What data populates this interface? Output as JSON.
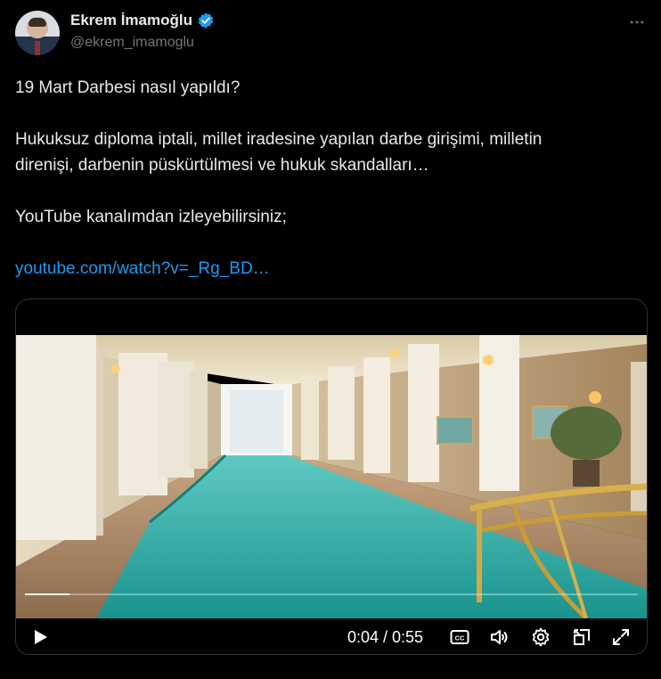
{
  "author": {
    "display_name": "Ekrem İmamoğlu",
    "handle": "@ekrem_imamoglu",
    "verified_icon": "verified-badge-icon"
  },
  "tweet": {
    "line1": "19 Mart Darbesi nasıl yapıldı?",
    "line2a": "Hukuksuz diploma iptali, millet iradesine yapılan darbe girişimi, milletin",
    "line2b": "direnişi, darbenin püskürtülmesi ve hukuk skandalları…",
    "line3": "YouTube kanalımdan izleyebilirsiniz;",
    "link": "youtube.com/watch?v=_Rg_BD…"
  },
  "video": {
    "time": "0:04 / 0:55",
    "progress": 0.073,
    "controls": {
      "play": "play-icon",
      "captions": "captions-icon",
      "volume": "volume-icon",
      "settings": "settings-icon",
      "pip": "picture-in-picture-icon",
      "fullscreen": "fullscreen-icon"
    }
  },
  "colors": {
    "background": "#000000",
    "text": "#e7e9ea",
    "muted": "#71767b",
    "link": "#1d9bf0",
    "verified": "#1d9bf0",
    "carpet": "#2fb3ad"
  }
}
